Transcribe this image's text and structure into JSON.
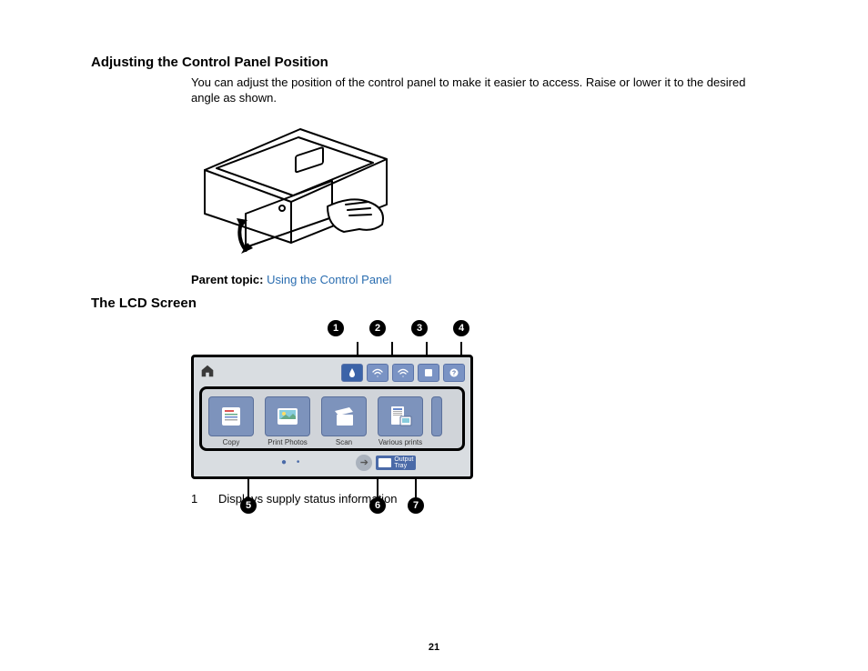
{
  "section1": {
    "heading": "Adjusting the Control Panel Position",
    "body": "You can adjust the position of the control panel to make it easier to access. Raise or lower it to the desired angle as shown.",
    "parent_topic_label": "Parent topic:",
    "parent_topic_link": "Using the Control Panel"
  },
  "section2": {
    "heading": "The LCD Screen",
    "callouts_top": [
      "1",
      "2",
      "3",
      "4"
    ],
    "callouts_bottom": {
      "c5": "5",
      "c6": "6",
      "c7": "7"
    },
    "tiles": [
      {
        "label": "Copy"
      },
      {
        "label": "Print Photos"
      },
      {
        "label": "Scan"
      },
      {
        "label": "Various prints"
      }
    ],
    "output_tray_label_1": "Output",
    "output_tray_label_2": "Tray",
    "legend": [
      {
        "n": "1",
        "text": "Displays supply status information"
      }
    ]
  },
  "page_number": "21"
}
